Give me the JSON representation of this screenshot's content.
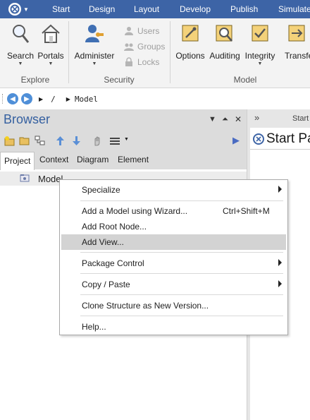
{
  "menubar": {
    "items": [
      "Start",
      "Design",
      "Layout",
      "Develop",
      "Publish",
      "Simulate"
    ]
  },
  "ribbon": {
    "buttons": {
      "search": "Search",
      "portals": "Portals",
      "administer": "Administer",
      "options": "Options",
      "auditing": "Auditing",
      "integrity": "Integrity",
      "transfer": "Transfer"
    },
    "small_buttons": {
      "users": "Users",
      "groups": "Groups",
      "locks": "Locks"
    },
    "groups": {
      "explore": "Explore",
      "security": "Security",
      "model": "Model"
    }
  },
  "pathbar": {
    "root": "/",
    "item": "Model"
  },
  "browser": {
    "title": "Browser",
    "tabs": [
      "Project",
      "Context",
      "Diagram",
      "Element"
    ],
    "tree": {
      "root_label": "Model"
    }
  },
  "start_pane": {
    "tab_label": "Start",
    "title": "Start Pa"
  },
  "context_menu": {
    "specialize": "Specialize",
    "add_model_wizard": "Add a Model using Wizard...",
    "add_model_wizard_shortcut": "Ctrl+Shift+M",
    "add_root_node": "Add Root Node...",
    "add_view": "Add View...",
    "package_control": "Package Control",
    "copy_paste": "Copy / Paste",
    "clone_structure": "Clone Structure as New Version...",
    "help": "Help..."
  }
}
